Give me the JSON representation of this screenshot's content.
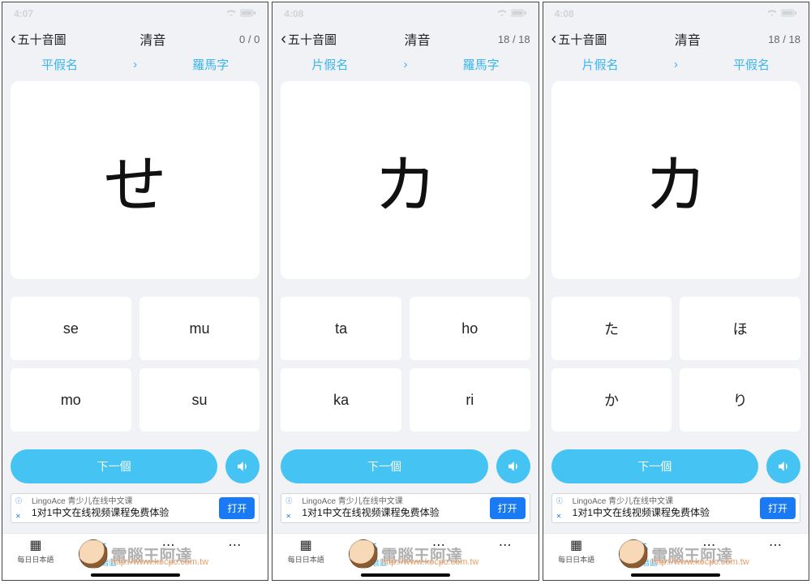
{
  "screens": [
    {
      "time": "4:07",
      "back": "五十音圖",
      "title": "清音",
      "counter": "0 / 0",
      "modeLeft": "平假名",
      "modeRight": "羅馬字",
      "glyph": "せ",
      "options": [
        "se",
        "mu",
        "mo",
        "su"
      ],
      "next": "下一個"
    },
    {
      "time": "4:08",
      "back": "五十音圖",
      "title": "清音",
      "counter": "18 / 18",
      "modeLeft": "片假名",
      "modeRight": "羅馬字",
      "glyph": "カ",
      "options": [
        "ta",
        "ho",
        "ka",
        "ri"
      ],
      "next": "下一個"
    },
    {
      "time": "4:08",
      "back": "五十音圖",
      "title": "清音",
      "counter": "18 / 18",
      "modeLeft": "片假名",
      "modeRight": "平假名",
      "glyph": "カ",
      "options": [
        "た",
        "ほ",
        "か",
        "り"
      ],
      "next": "下一個"
    }
  ],
  "ad": {
    "top": "LingoAce 青少儿在线中文课",
    "bottom": "1对1中文在线视频课程免费体验",
    "cta": "打开"
  },
  "tabs": {
    "t1": "每日日本語",
    "t2": "五十音圖"
  },
  "watermark": {
    "text": "電腦王阿達",
    "url": "http://www.kocpc.com.tw"
  }
}
